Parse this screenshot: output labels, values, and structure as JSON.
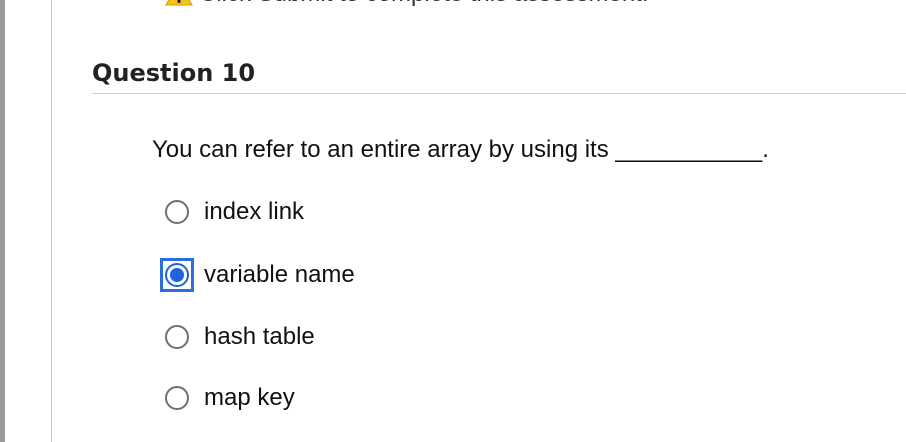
{
  "top_warning": {
    "text": "Click Submit to complete this assessment."
  },
  "question": {
    "title": "Question 10",
    "prompt": "You can refer to an entire array by using its ___________."
  },
  "options": [
    {
      "label": "index link"
    },
    {
      "label": "variable name"
    },
    {
      "label": "hash table"
    },
    {
      "label": "map key"
    }
  ],
  "selected_option": "variable name",
  "colors": {
    "selection_border": "#2d6ddf",
    "selection_fill": "#1f63e3",
    "divider": "#cfcfcf"
  }
}
